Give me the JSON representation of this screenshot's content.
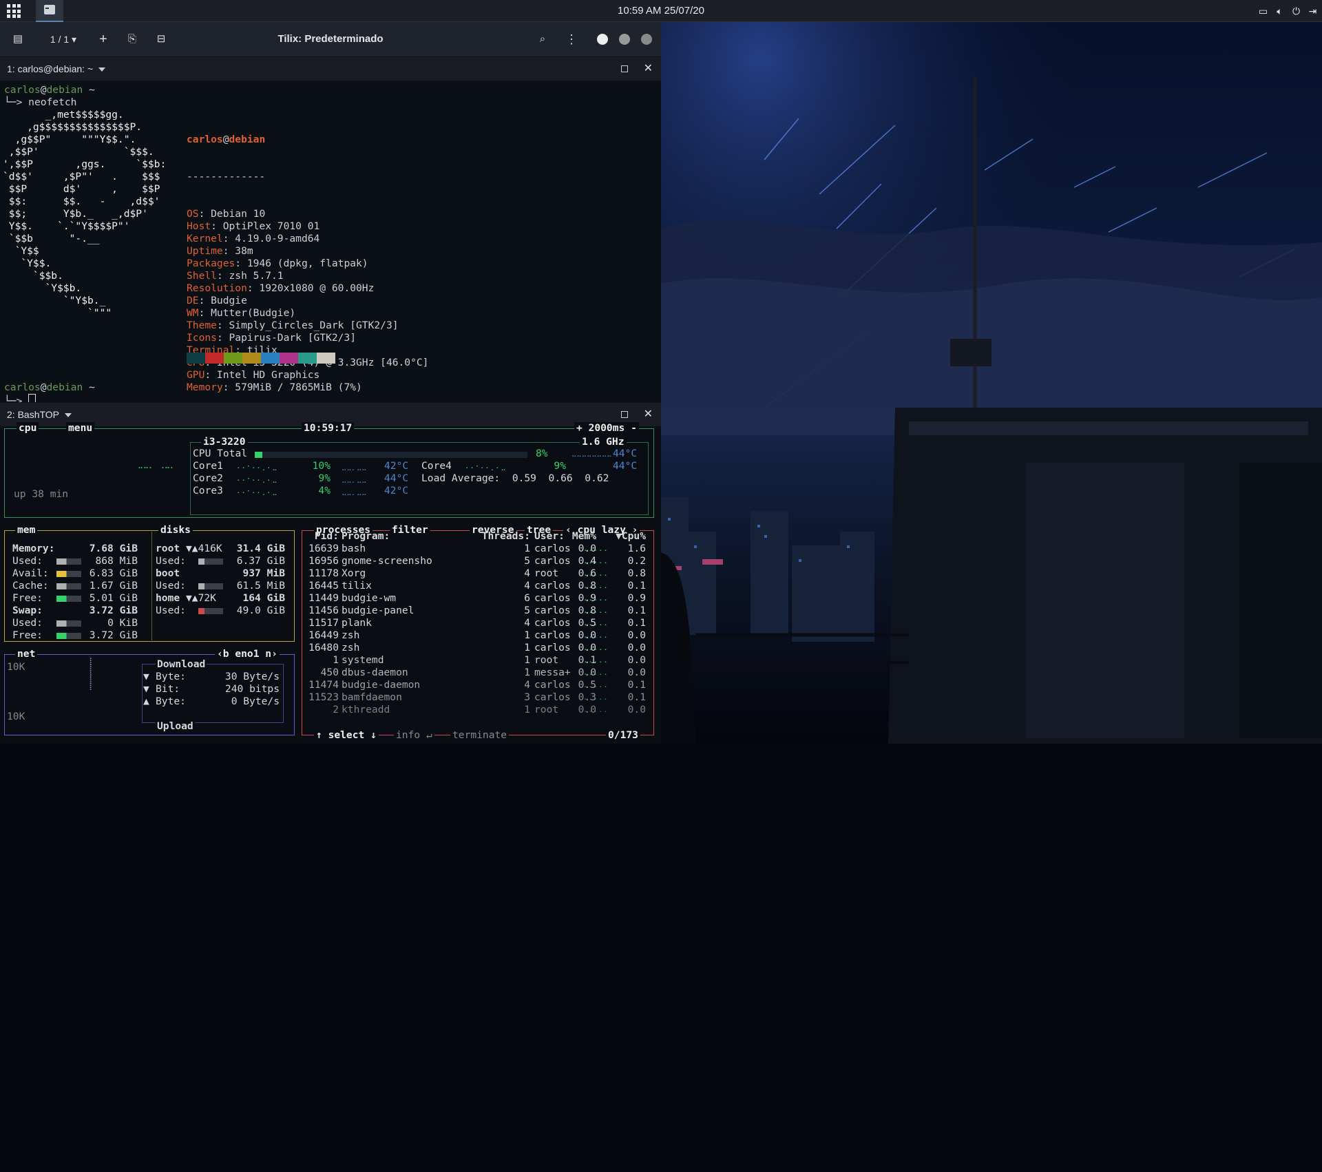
{
  "panel": {
    "clock": "10:59 AM  25/07/20",
    "tray": [
      "screen-icon",
      "volume-icon",
      "power-icon",
      "logout-icon"
    ]
  },
  "tilix": {
    "tab_counter": "1 / 1",
    "title": "Tilix: Predeterminado",
    "terminal1_title": "1: carlos@debian: ~",
    "terminal2_title": "2:  BashTOP"
  },
  "shell": {
    "prompt_user": "carlos",
    "prompt_at": "@",
    "prompt_host": "debian",
    "prompt_dir": " ~",
    "arrow": "└─>",
    "command": "neofetch"
  },
  "neofetch": {
    "logo": [
      "       _,met$$$$$gg.",
      "    ,g$$$$$$$$$$$$$$$P.",
      "  ,g$$P\"     \"\"\"Y$$.\".",
      " ,$$P'              `$$$.",
      "',$$P       ,ggs.     `$$b:",
      "`d$$'     ,$P\"'   .    $$$",
      " $$P      d$'     ,    $$P",
      " $$:      $$.   -    ,d$$'",
      " $$;      Y$b._   _,d$P'",
      " Y$$.    `.`\"Y$$$$P\"'",
      " `$$b      \"-.__",
      "  `Y$$",
      "   `Y$$.",
      "     `$$b.",
      "       `Y$$b.",
      "          `\"Y$b._",
      "              `\"\"\""
    ],
    "user": "carlos",
    "at": "@",
    "host": "debian",
    "separator": "-------------",
    "info": [
      {
        "key": "OS",
        "value": ": Debian 10"
      },
      {
        "key": "Host",
        "value": ": OptiPlex 7010 01"
      },
      {
        "key": "Kernel",
        "value": ": 4.19.0-9-amd64"
      },
      {
        "key": "Uptime",
        "value": ": 38m"
      },
      {
        "key": "Packages",
        "value": ": 1946 (dpkg, flatpak)"
      },
      {
        "key": "Shell",
        "value": ": zsh 5.7.1"
      },
      {
        "key": "Resolution",
        "value": ": 1920x1080 @ 60.00Hz"
      },
      {
        "key": "DE",
        "value": ": Budgie"
      },
      {
        "key": "WM",
        "value": ": Mutter(Budgie)"
      },
      {
        "key": "Theme",
        "value": ": Simply_Circles_Dark [GTK2/3]"
      },
      {
        "key": "Icons",
        "value": ": Papirus-Dark [GTK2/3]"
      },
      {
        "key": "Terminal",
        "value": ": tilix"
      },
      {
        "key": "CPU",
        "value": ": Intel i3-3220 (4) @ 3.3GHz [46.0°C]"
      },
      {
        "key": "GPU",
        "value": ": Intel HD Graphics"
      },
      {
        "key": "Memory",
        "value": ": 579MiB / 7865MiB (7%)"
      }
    ],
    "palette": [
      "#0f3d46",
      "#c52a2a",
      "#6e9a1a",
      "#b08a1a",
      "#2a7fbf",
      "#b0348a",
      "#2a9a8a",
      "#cfcac0"
    ]
  },
  "bashtop": {
    "cpu": {
      "tab": "cpu",
      "menu": "menu",
      "clock": "10:59:17",
      "interval": "+ 2000ms -",
      "model": "i3-3220",
      "freq": "1.6 GHz",
      "uptime": "up 38 min",
      "total_label": "CPU Total",
      "total_pct": "8%",
      "total_temp": "44°C",
      "total_pct_value": 8,
      "cores": [
        {
          "name": "Core1",
          "pct": "10%",
          "temp": "42°C"
        },
        {
          "name": "Core2",
          "pct": "9%",
          "temp": "44°C"
        },
        {
          "name": "Core3",
          "pct": "4%",
          "temp": "42°C"
        },
        {
          "name": "Core4",
          "pct": "9%",
          "temp": "44°C"
        }
      ],
      "load_label": "Load Average:",
      "load": [
        "0.59",
        "0.66",
        "0.62"
      ]
    },
    "mem": {
      "tab": "mem",
      "rows": [
        {
          "label": "Memory:",
          "value": "7.68 GiB",
          "bold": true
        },
        {
          "label": "Used:",
          "value": "868 MiB"
        },
        {
          "label": "Avail:",
          "value": "6.83 GiB"
        },
        {
          "label": "Cache:",
          "value": "1.67 GiB"
        },
        {
          "label": "Free:",
          "value": "5.01 GiB"
        },
        {
          "label": "Swap:",
          "value": "3.72 GiB",
          "bold": true
        },
        {
          "label": "Used:",
          "value": "0 KiB"
        },
        {
          "label": "Free:",
          "value": "3.72 GiB"
        }
      ]
    },
    "disks": {
      "tab": "disks",
      "rows": [
        {
          "label": "root",
          "io": "▼▲416K",
          "value": "31.4 GiB",
          "bold": true
        },
        {
          "label": "Used:",
          "io": "",
          "value": "6.37 GiB"
        },
        {
          "label": "boot",
          "io": "",
          "value": "937 MiB",
          "bold": true
        },
        {
          "label": "Used:",
          "io": "",
          "value": "61.5 MiB"
        },
        {
          "label": "home",
          "io": "▼▲72K",
          "value": "164 GiB",
          "bold": true
        },
        {
          "label": "Used:",
          "io": "",
          "value": "49.0 GiB"
        }
      ]
    },
    "net": {
      "tab": "net",
      "iface": "‹b eno1 n›",
      "scale_top": "10K",
      "scale_bottom": "10K",
      "download": "Download",
      "rows": [
        {
          "arrow": "▼",
          "label": "Byte:",
          "value": "30 Byte/s"
        },
        {
          "arrow": "▼",
          "label": "Bit:",
          "value": "240 bitps"
        },
        {
          "arrow": "▲",
          "label": "Byte:",
          "value": "0 Byte/s"
        }
      ],
      "upload": "Upload"
    },
    "proc": {
      "tab": "processes",
      "filter": "filter",
      "reverse": "reverse",
      "tree": "tree",
      "sort": "‹ cpu lazy ›",
      "headers": {
        "pid": "Pid:",
        "program": "Program:",
        "threads": "Threads:",
        "user": "User:",
        "mem": "Mem%",
        "cpu": "▼Cpu%"
      },
      "rows": [
        {
          "pid": "16639",
          "program": "bash",
          "threads": "1",
          "user": "carlos",
          "mem": "0.0",
          "cpu": "1.6"
        },
        {
          "pid": "16956",
          "program": "gnome-screensho",
          "threads": "5",
          "user": "carlos",
          "mem": "0.4",
          "cpu": "0.2"
        },
        {
          "pid": "11178",
          "program": "Xorg",
          "threads": "4",
          "user": "root",
          "mem": "0.6",
          "cpu": "0.8"
        },
        {
          "pid": "16445",
          "program": "tilix",
          "threads": "4",
          "user": "carlos",
          "mem": "0.8",
          "cpu": "0.1"
        },
        {
          "pid": "11449",
          "program": "budgie-wm",
          "threads": "6",
          "user": "carlos",
          "mem": "0.9",
          "cpu": "0.9"
        },
        {
          "pid": "11456",
          "program": "budgie-panel",
          "threads": "5",
          "user": "carlos",
          "mem": "0.8",
          "cpu": "0.1"
        },
        {
          "pid": "11517",
          "program": "plank",
          "threads": "4",
          "user": "carlos",
          "mem": "0.5",
          "cpu": "0.1"
        },
        {
          "pid": "16449",
          "program": "zsh",
          "threads": "1",
          "user": "carlos",
          "mem": "0.0",
          "cpu": "0.0"
        },
        {
          "pid": "16480",
          "program": "zsh",
          "threads": "1",
          "user": "carlos",
          "mem": "0.0",
          "cpu": "0.0"
        },
        {
          "pid": "1",
          "program": "systemd",
          "threads": "1",
          "user": "root",
          "mem": "0.1",
          "cpu": "0.0"
        },
        {
          "pid": "450",
          "program": "dbus-daemon",
          "threads": "1",
          "user": "messa+",
          "mem": "0.0",
          "cpu": "0.0"
        },
        {
          "pid": "11474",
          "program": "budgie-daemon",
          "threads": "4",
          "user": "carlos",
          "mem": "0.5",
          "cpu": "0.1"
        },
        {
          "pid": "11523",
          "program": "bamfdaemon",
          "threads": "3",
          "user": "carlos",
          "mem": "0.3",
          "cpu": "0.1"
        },
        {
          "pid": "2",
          "program": "kthreadd",
          "threads": "1",
          "user": "root",
          "mem": "0.0",
          "cpu": "0.0"
        }
      ],
      "select": "↑ select ↓",
      "info": "info ↵",
      "terminate": "terminate",
      "count": "0/173"
    }
  }
}
